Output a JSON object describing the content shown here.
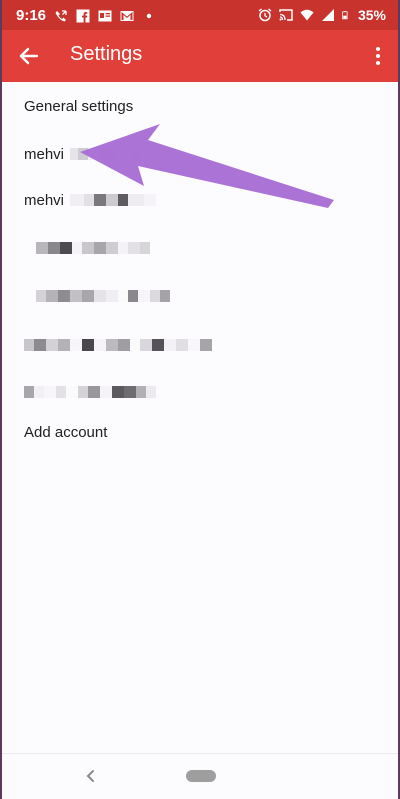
{
  "status_bar": {
    "time": "9:16",
    "battery": "35%",
    "icons_left": [
      "missed-call-icon",
      "facebook-icon",
      "news-icon",
      "gmail-icon",
      "dot-icon"
    ],
    "icons_right": [
      "alarm-icon",
      "cast-icon",
      "wifi-icon",
      "signal-icon",
      "battery-icon"
    ]
  },
  "app_bar": {
    "title": "Settings",
    "back_icon": "arrow-back-icon",
    "menu_icon": "more-vert-icon",
    "color": "#e1403a"
  },
  "list": {
    "general_settings": "General settings",
    "account_1": "mehvi",
    "account_2": "mehvi",
    "add_account": "Add account"
  },
  "annotation": {
    "arrow_color": "#a86bd4"
  }
}
